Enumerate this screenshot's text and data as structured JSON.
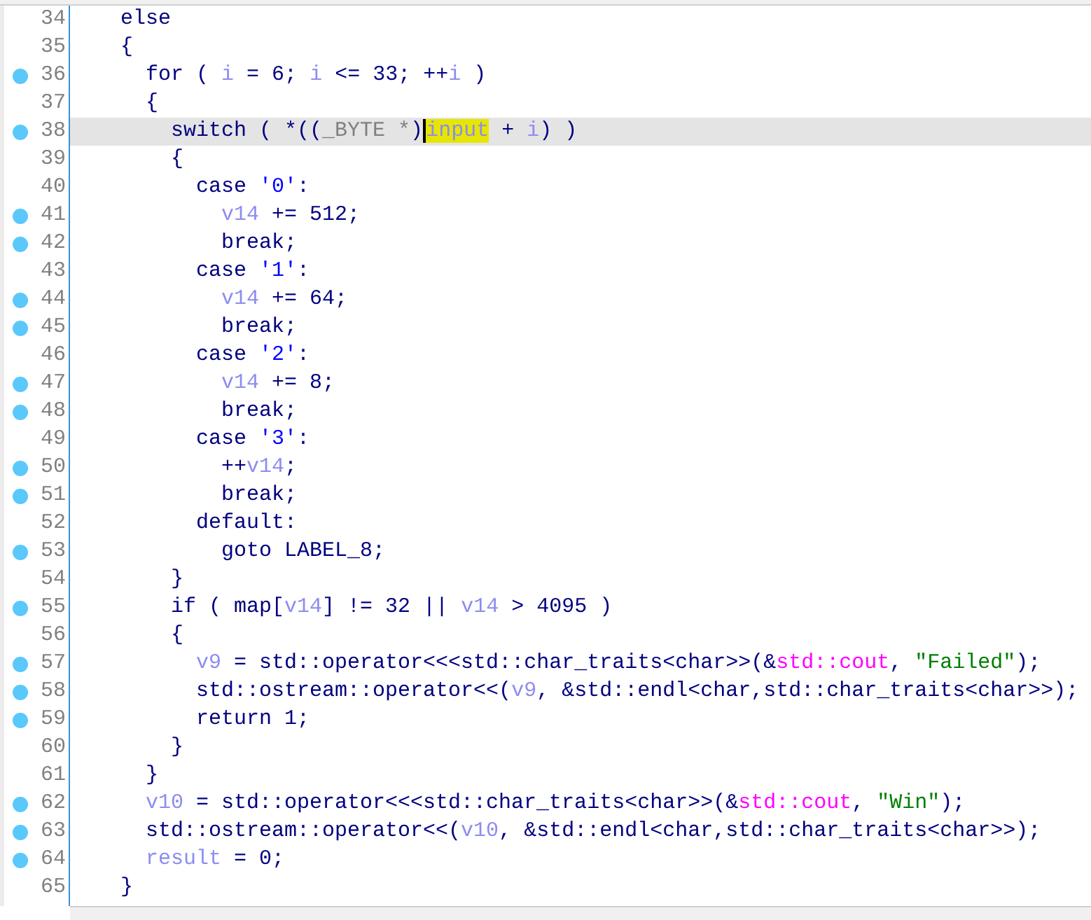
{
  "lines": [
    {
      "number": "34",
      "marker": false,
      "selected": false,
      "tokens": [
        {
          "text": "    else",
          "kind": "k"
        }
      ]
    },
    {
      "number": "35",
      "marker": false,
      "selected": false,
      "tokens": [
        {
          "text": "    {",
          "kind": "k"
        }
      ]
    },
    {
      "number": "36",
      "marker": true,
      "selected": false,
      "tokens": [
        {
          "text": "      for ( ",
          "kind": "k"
        },
        {
          "text": "i",
          "kind": "v"
        },
        {
          "text": " = 6; ",
          "kind": "k"
        },
        {
          "text": "i",
          "kind": "v"
        },
        {
          "text": " <= 33; ++",
          "kind": "k"
        },
        {
          "text": "i",
          "kind": "v"
        },
        {
          "text": " )",
          "kind": "k"
        }
      ]
    },
    {
      "number": "37",
      "marker": false,
      "selected": false,
      "tokens": [
        {
          "text": "      {",
          "kind": "k"
        }
      ]
    },
    {
      "number": "38",
      "marker": true,
      "selected": true,
      "tokens": [
        {
          "text": "        switch ( *((",
          "kind": "k"
        },
        {
          "text": "_BYTE *",
          "kind": "t"
        },
        {
          "text": ")",
          "kind": "k"
        },
        {
          "text": "input",
          "kind": "h"
        },
        {
          "text": " + ",
          "kind": "k"
        },
        {
          "text": "i",
          "kind": "v"
        },
        {
          "text": ") )",
          "kind": "k"
        }
      ]
    },
    {
      "number": "39",
      "marker": false,
      "selected": false,
      "tokens": [
        {
          "text": "        {",
          "kind": "k"
        }
      ]
    },
    {
      "number": "40",
      "marker": false,
      "selected": false,
      "tokens": [
        {
          "text": "          case ",
          "kind": "k"
        },
        {
          "text": "'0'",
          "kind": "c"
        },
        {
          "text": ":",
          "kind": "k"
        }
      ]
    },
    {
      "number": "41",
      "marker": true,
      "selected": false,
      "tokens": [
        {
          "text": "            v14",
          "kind": "v"
        },
        {
          "text": " += 512;",
          "kind": "k"
        }
      ]
    },
    {
      "number": "42",
      "marker": true,
      "selected": false,
      "tokens": [
        {
          "text": "            break;",
          "kind": "k"
        }
      ]
    },
    {
      "number": "43",
      "marker": false,
      "selected": false,
      "tokens": [
        {
          "text": "          case ",
          "kind": "k"
        },
        {
          "text": "'1'",
          "kind": "c"
        },
        {
          "text": ":",
          "kind": "k"
        }
      ]
    },
    {
      "number": "44",
      "marker": true,
      "selected": false,
      "tokens": [
        {
          "text": "            v14",
          "kind": "v"
        },
        {
          "text": " += 64;",
          "kind": "k"
        }
      ]
    },
    {
      "number": "45",
      "marker": true,
      "selected": false,
      "tokens": [
        {
          "text": "            break;",
          "kind": "k"
        }
      ]
    },
    {
      "number": "46",
      "marker": false,
      "selected": false,
      "tokens": [
        {
          "text": "          case ",
          "kind": "k"
        },
        {
          "text": "'2'",
          "kind": "c"
        },
        {
          "text": ":",
          "kind": "k"
        }
      ]
    },
    {
      "number": "47",
      "marker": true,
      "selected": false,
      "tokens": [
        {
          "text": "            v14",
          "kind": "v"
        },
        {
          "text": " += 8;",
          "kind": "k"
        }
      ]
    },
    {
      "number": "48",
      "marker": true,
      "selected": false,
      "tokens": [
        {
          "text": "            break;",
          "kind": "k"
        }
      ]
    },
    {
      "number": "49",
      "marker": false,
      "selected": false,
      "tokens": [
        {
          "text": "          case ",
          "kind": "k"
        },
        {
          "text": "'3'",
          "kind": "c"
        },
        {
          "text": ":",
          "kind": "k"
        }
      ]
    },
    {
      "number": "50",
      "marker": true,
      "selected": false,
      "tokens": [
        {
          "text": "            ++",
          "kind": "k"
        },
        {
          "text": "v14",
          "kind": "v"
        },
        {
          "text": ";",
          "kind": "k"
        }
      ]
    },
    {
      "number": "51",
      "marker": true,
      "selected": false,
      "tokens": [
        {
          "text": "            break;",
          "kind": "k"
        }
      ]
    },
    {
      "number": "52",
      "marker": false,
      "selected": false,
      "tokens": [
        {
          "text": "          default:",
          "kind": "k"
        }
      ]
    },
    {
      "number": "53",
      "marker": true,
      "selected": false,
      "tokens": [
        {
          "text": "            goto LABEL_8;",
          "kind": "k"
        }
      ]
    },
    {
      "number": "54",
      "marker": false,
      "selected": false,
      "tokens": [
        {
          "text": "        }",
          "kind": "k"
        }
      ]
    },
    {
      "number": "55",
      "marker": true,
      "selected": false,
      "tokens": [
        {
          "text": "        if ( map[",
          "kind": "k"
        },
        {
          "text": "v14",
          "kind": "v"
        },
        {
          "text": "] != 32 || ",
          "kind": "k"
        },
        {
          "text": "v14",
          "kind": "v"
        },
        {
          "text": " > 4095 )",
          "kind": "k"
        }
      ]
    },
    {
      "number": "56",
      "marker": false,
      "selected": false,
      "tokens": [
        {
          "text": "        {",
          "kind": "k"
        }
      ]
    },
    {
      "number": "57",
      "marker": true,
      "selected": false,
      "tokens": [
        {
          "text": "          v9",
          "kind": "v"
        },
        {
          "text": " = std::operator<<<std::char_traits<char>>(&",
          "kind": "k"
        },
        {
          "text": "std::cout",
          "kind": "g"
        },
        {
          "text": ", ",
          "kind": "k"
        },
        {
          "text": "\"Failed\"",
          "kind": "s"
        },
        {
          "text": ");",
          "kind": "k"
        }
      ]
    },
    {
      "number": "58",
      "marker": true,
      "selected": false,
      "tokens": [
        {
          "text": "          std::ostream::operator<<(",
          "kind": "k"
        },
        {
          "text": "v9",
          "kind": "v"
        },
        {
          "text": ", &std::endl<char,std::char_traits<char>>);",
          "kind": "k"
        }
      ]
    },
    {
      "number": "59",
      "marker": true,
      "selected": false,
      "tokens": [
        {
          "text": "          return 1;",
          "kind": "k"
        }
      ]
    },
    {
      "number": "60",
      "marker": false,
      "selected": false,
      "tokens": [
        {
          "text": "        }",
          "kind": "k"
        }
      ]
    },
    {
      "number": "61",
      "marker": false,
      "selected": false,
      "tokens": [
        {
          "text": "      }",
          "kind": "k"
        }
      ]
    },
    {
      "number": "62",
      "marker": true,
      "selected": false,
      "tokens": [
        {
          "text": "      v10",
          "kind": "v"
        },
        {
          "text": " = std::operator<<<std::char_traits<char>>(&",
          "kind": "k"
        },
        {
          "text": "std::cout",
          "kind": "g"
        },
        {
          "text": ", ",
          "kind": "k"
        },
        {
          "text": "\"Win\"",
          "kind": "s"
        },
        {
          "text": ");",
          "kind": "k"
        }
      ]
    },
    {
      "number": "63",
      "marker": true,
      "selected": false,
      "tokens": [
        {
          "text": "      std::ostream::operator<<(",
          "kind": "k"
        },
        {
          "text": "v10",
          "kind": "v"
        },
        {
          "text": ", &std::endl<char,std::char_traits<char>>);",
          "kind": "k"
        }
      ]
    },
    {
      "number": "64",
      "marker": true,
      "selected": false,
      "tokens": [
        {
          "text": "      result",
          "kind": "v"
        },
        {
          "text": " = 0;",
          "kind": "k"
        }
      ]
    },
    {
      "number": "65",
      "marker": false,
      "selected": false,
      "tokens": [
        {
          "text": "    }",
          "kind": "k"
        }
      ]
    }
  ]
}
